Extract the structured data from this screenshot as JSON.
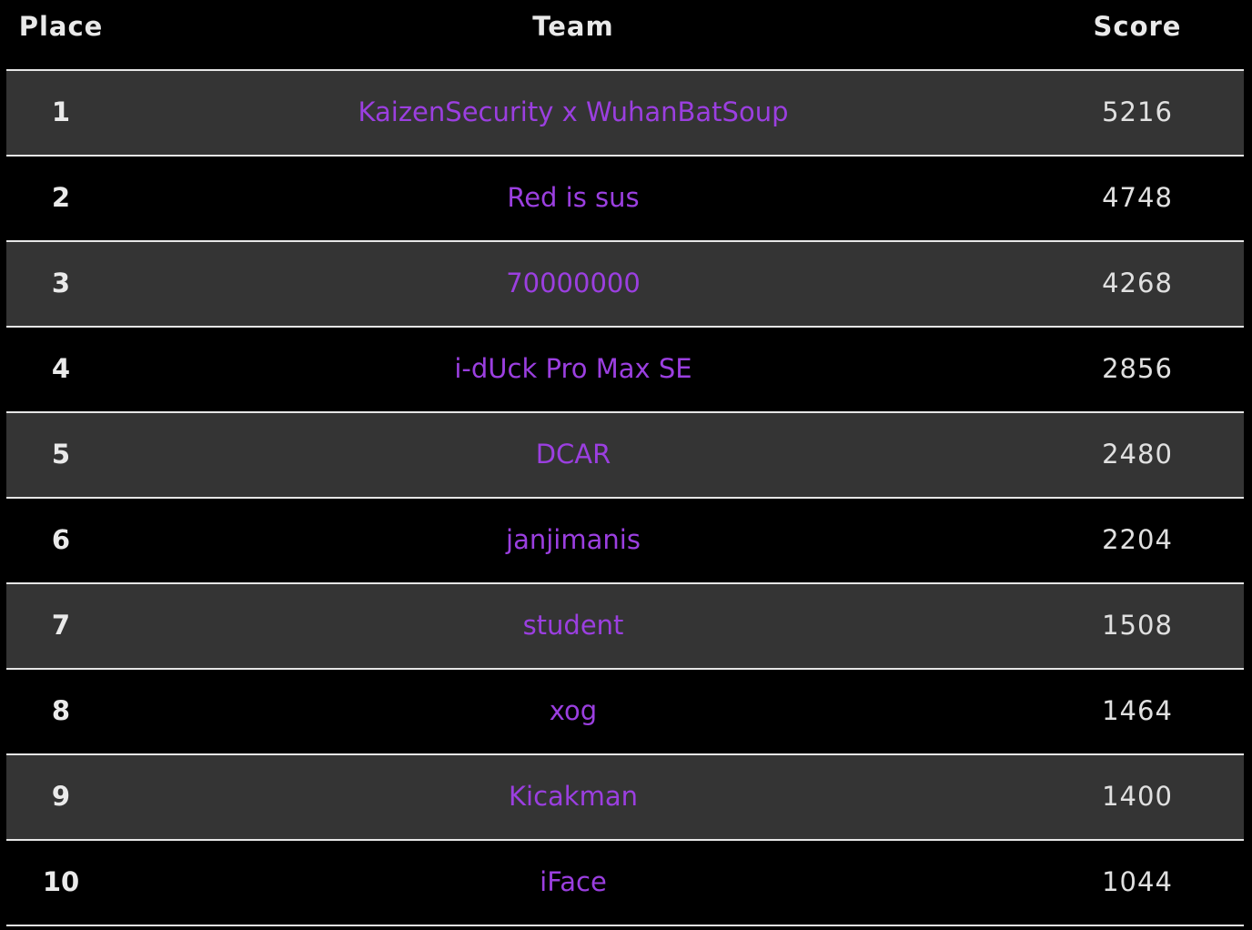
{
  "headers": {
    "place": "Place",
    "team": "Team",
    "score": "Score"
  },
  "colors": {
    "background": "#000000",
    "row_alt": "#343434",
    "team_link": "#9b3fe0",
    "text": "#e9e9e9",
    "divider": "#e6e6e6"
  },
  "rows": [
    {
      "place": "1",
      "team": "KaizenSecurity x WuhanBatSoup",
      "score": "5216"
    },
    {
      "place": "2",
      "team": "Red is sus",
      "score": "4748"
    },
    {
      "place": "3",
      "team": "70000000",
      "score": "4268"
    },
    {
      "place": "4",
      "team": "i-dUck Pro Max SE",
      "score": "2856"
    },
    {
      "place": "5",
      "team": "DCAR",
      "score": "2480"
    },
    {
      "place": "6",
      "team": "janjimanis",
      "score": "2204"
    },
    {
      "place": "7",
      "team": "student",
      "score": "1508"
    },
    {
      "place": "8",
      "team": "xog",
      "score": "1464"
    },
    {
      "place": "9",
      "team": "Kicakman",
      "score": "1400"
    },
    {
      "place": "10",
      "team": "iFace",
      "score": "1044"
    }
  ]
}
